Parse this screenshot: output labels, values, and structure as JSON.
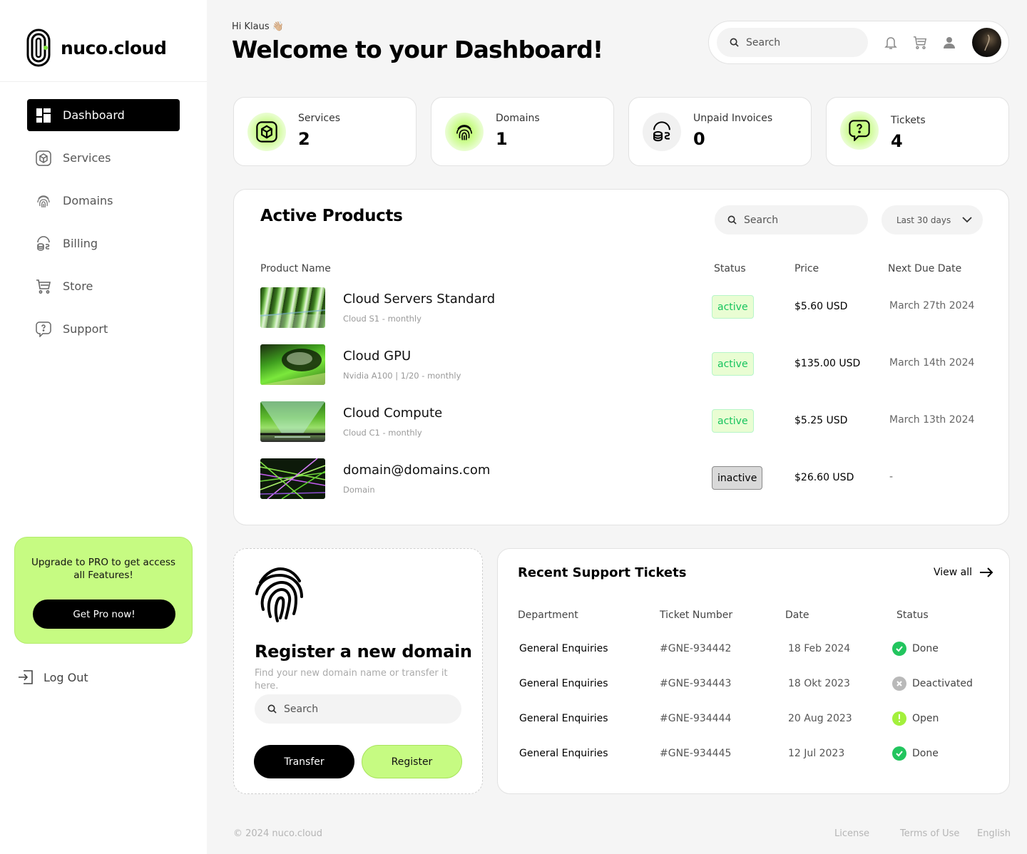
{
  "brand": {
    "name": "nuco.cloud"
  },
  "sidebar": {
    "items": [
      {
        "label": "Dashboard",
        "icon": "dashboard-icon"
      },
      {
        "label": "Services",
        "icon": "cube-icon"
      },
      {
        "label": "Domains",
        "icon": "fingerprint-icon"
      },
      {
        "label": "Billing",
        "icon": "coins-icon"
      },
      {
        "label": "Store",
        "icon": "cart-icon"
      },
      {
        "label": "Support",
        "icon": "question-chat-icon"
      }
    ],
    "promo": {
      "text": "Upgrade to  PRO to get access all Features!",
      "button": "Get Pro now!"
    },
    "logout": "Log Out"
  },
  "header": {
    "greeting": "Hi Klaus 👋🏼",
    "title": "Welcome to your Dashboard!",
    "search_placeholder": "Search"
  },
  "stats": [
    {
      "label": "Services",
      "value": "2"
    },
    {
      "label": "Domains",
      "value": "1"
    },
    {
      "label": "Unpaid Invoices",
      "value": "0"
    },
    {
      "label": "Tickets",
      "value": "4"
    }
  ],
  "products": {
    "title": "Active Products",
    "search_placeholder": "Search",
    "range": "Last 30 days",
    "columns": [
      "Product Name",
      "Status",
      "Price",
      "Next Due Date"
    ],
    "rows": [
      {
        "name": "Cloud Servers Standard",
        "sub": "Cloud S1 - monthly",
        "status": "active",
        "price": "$5.60 USD",
        "due": "March 27th 2024"
      },
      {
        "name": "Cloud GPU",
        "sub": "Nvidia A100 | 1/20 - monthly",
        "status": "active",
        "price": "$135.00 USD",
        "due": "March 14th 2024"
      },
      {
        "name": "Cloud Compute",
        "sub": "Cloud C1 - monthly",
        "status": "active",
        "price": "$5.25 USD",
        "due": "March 13th 2024"
      },
      {
        "name": "domain@domains.com",
        "sub": "Domain",
        "status": "inactive",
        "price": "$26.60 USD",
        "due": "-"
      }
    ]
  },
  "register": {
    "title": "Register a new domain",
    "desc": "Find your new domain name or transfer it here.",
    "search_placeholder": "Search",
    "transfer": "Transfer",
    "register": "Register"
  },
  "tickets": {
    "title": "Recent Support Tickets",
    "view_all": "View all",
    "columns": [
      "Department",
      "Ticket Number",
      "Date",
      "Status"
    ],
    "rows": [
      {
        "dept": "General Enquiries",
        "number": "#GNE-934442",
        "date": "18 Feb 2024",
        "status": "Done"
      },
      {
        "dept": "General Enquiries",
        "number": "#GNE-934443",
        "date": "18 Okt 2023",
        "status": "Deactivated"
      },
      {
        "dept": "General Enquiries",
        "number": "#GNE-934444",
        "date": "20 Aug 2023",
        "status": "Open"
      },
      {
        "dept": "General Enquiries",
        "number": "#GNE-934445",
        "date": "12 Jul 2023",
        "status": "Done"
      }
    ]
  },
  "footer": {
    "copyright": "© 2024 nuco.cloud",
    "license": "License",
    "terms": "Terms of Use",
    "language": "English"
  },
  "colors": {
    "accent": "#c6fb82",
    "active_text": "#17c45e",
    "done": "#22c55e",
    "deactivated": "#b9b9b9",
    "open": "#a3f03c"
  }
}
